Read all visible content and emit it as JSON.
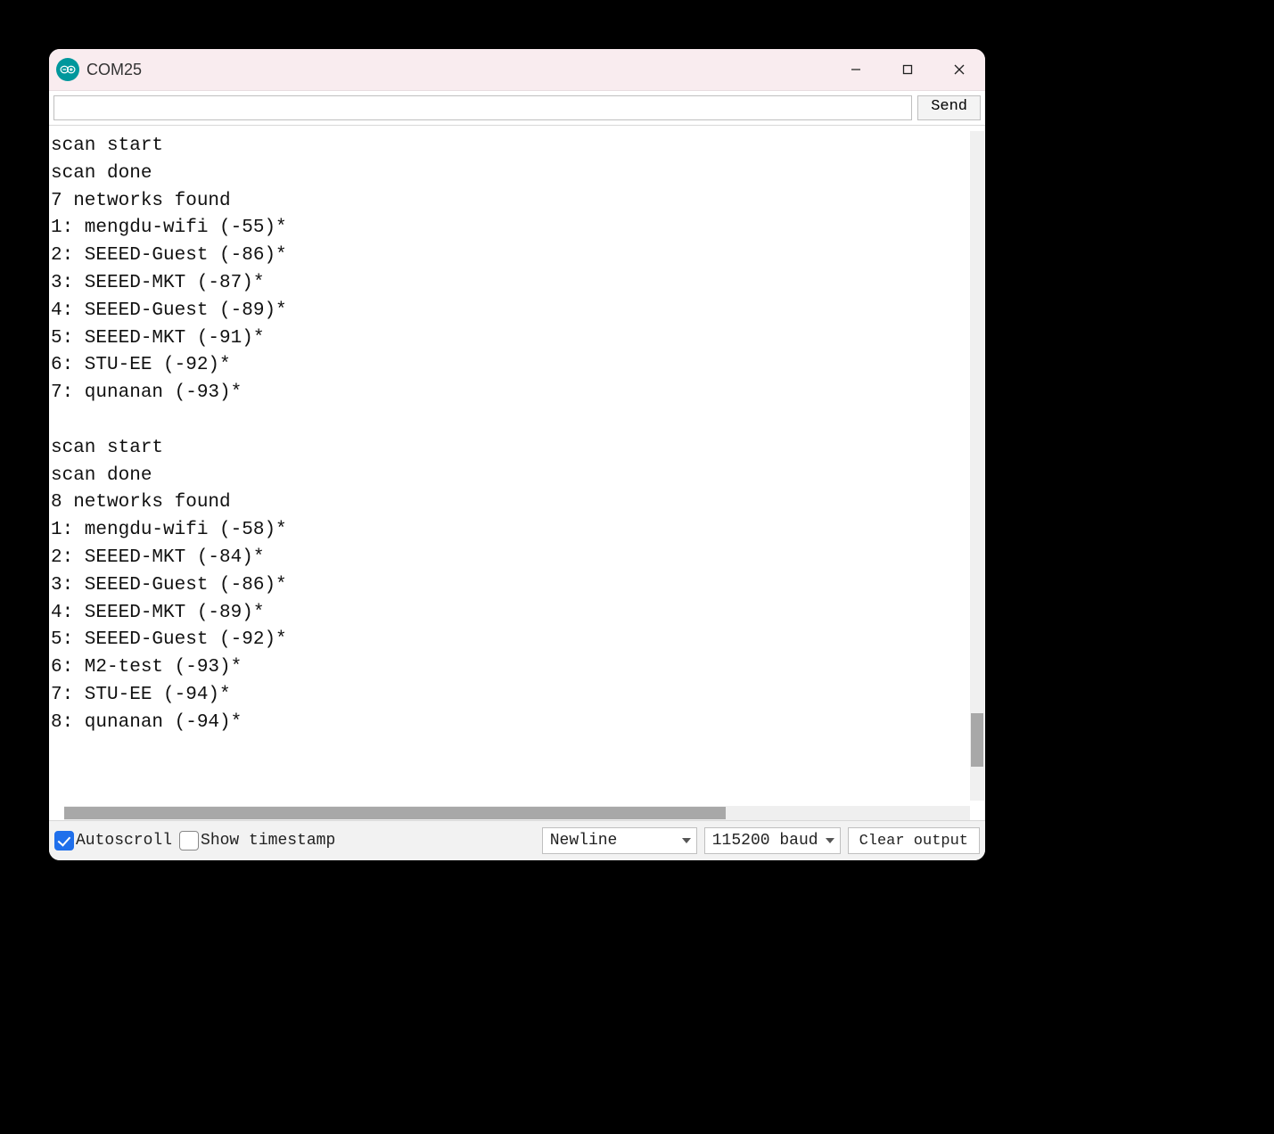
{
  "window": {
    "title": "COM25"
  },
  "send": {
    "input_value": "",
    "placeholder": "",
    "button_label": "Send"
  },
  "console_text": "scan start\nscan done\n7 networks found\n1: mengdu-wifi (-55)*\n2: SEEED-Guest (-86)*\n3: SEEED-MKT (-87)*\n4: SEEED-Guest (-89)*\n5: SEEED-MKT (-91)*\n6: STU-EE (-92)*\n7: qunanan (-93)*\n\nscan start\nscan done\n8 networks found\n1: mengdu-wifi (-58)*\n2: SEEED-MKT (-84)*\n3: SEEED-Guest (-86)*\n4: SEEED-MKT (-89)*\n5: SEEED-Guest (-92)*\n6: M2-test (-93)*\n7: STU-EE (-94)*\n8: qunanan (-94)*\n",
  "footer": {
    "autoscroll_label": "Autoscroll",
    "autoscroll_checked": true,
    "timestamp_label": "Show timestamp",
    "timestamp_checked": false,
    "line_ending_selected": "Newline",
    "baud_selected": "115200 baud",
    "clear_label": "Clear output"
  }
}
